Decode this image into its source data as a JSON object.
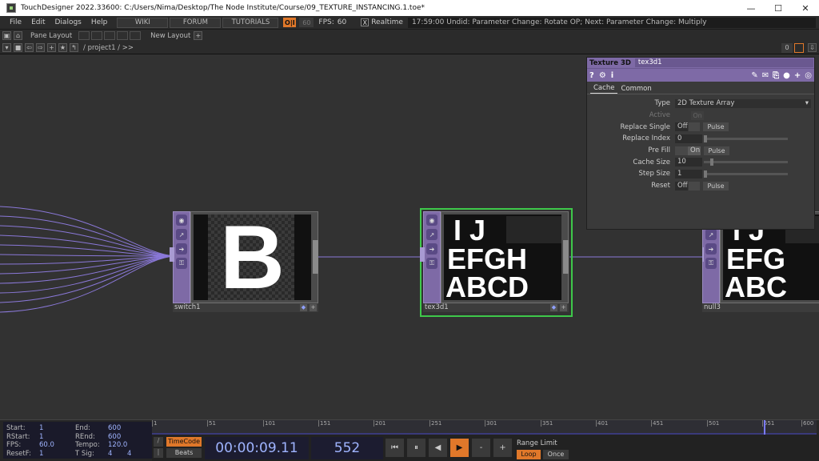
{
  "window": {
    "title": "TouchDesigner 2022.33600: C:/Users/Nima/Desktop/The Node Institute/Course/09_TEXTURE_INSTANCING.1.toe*",
    "minimize": "—",
    "maximize": "☐",
    "close": "✕"
  },
  "menubar": {
    "items": [
      "File",
      "Edit",
      "Dialogs",
      "Help"
    ],
    "wiki": "WIKI",
    "forum": "FORUM",
    "tutorials": "TUTORIALS",
    "perform": "O|I",
    "fps_target": "60",
    "fps_label": "FPS:",
    "fps_value": "60",
    "realtime_check": "X",
    "realtime_label": "Realtime",
    "status": "17:59:00 Undid: Parameter Change: Rotate OP; Next: Parameter Change: Multiply"
  },
  "panebar": {
    "pane_layout": "Pane Layout",
    "new_layout": "New Layout",
    "add": "+"
  },
  "pathbar": {
    "path": "/ project1 / >>",
    "counter": "0"
  },
  "nodes": {
    "switch1": {
      "name": "switch1",
      "letter": "B"
    },
    "tex3d1": {
      "name": "tex3d1",
      "row1": "I J",
      "row2": "EFGH",
      "row3": "ABCD"
    },
    "null3": {
      "name": "null3",
      "row1": "I J",
      "row2": "EFG",
      "row3": "ABC"
    }
  },
  "params": {
    "op_type": "Texture 3D",
    "op_name": "tex3d1",
    "tabs": [
      "Cache",
      "Common"
    ],
    "type_label": "Type",
    "type_value": "2D Texture Array",
    "active_label": "Active",
    "active_value": "On",
    "replace_single_label": "Replace Single",
    "replace_single_value": "Off",
    "pulse": "Pulse",
    "replace_index_label": "Replace Index",
    "replace_index_value": "0",
    "prefill_label": "Pre Fill",
    "prefill_value": "On",
    "cache_size_label": "Cache Size",
    "cache_size_value": "10",
    "step_size_label": "Step Size",
    "step_size_value": "1",
    "reset_label": "Reset",
    "reset_value": "Off"
  },
  "timeline": {
    "start_label": "Start:",
    "start": "1",
    "rstart_label": "RStart:",
    "rstart": "1",
    "fps_label": "FPS:",
    "fps": "60.0",
    "resetf_label": "ResetF:",
    "resetf": "1",
    "end_label": "End:",
    "end": "600",
    "rend_label": "REnd:",
    "rend": "600",
    "tempo_label": "Tempo:",
    "tempo": "120.0",
    "tsig_label": "T Sig:",
    "tsig_a": "4",
    "tsig_b": "4",
    "ticks": [
      "1",
      "51",
      "101",
      "151",
      "201",
      "251",
      "301",
      "351",
      "401",
      "451",
      "501",
      "551",
      "600"
    ],
    "timecode": "TimeCode",
    "beats": "Beats",
    "clock": "00:00:09.11",
    "frame": "552",
    "range_limit": "Range Limit",
    "loop": "Loop",
    "once": "Once",
    "btn_start": "⏮",
    "btn_pause": "⏸",
    "btn_back": "◀",
    "btn_play": "▶",
    "btn_minus": "-",
    "btn_plus": "+"
  }
}
